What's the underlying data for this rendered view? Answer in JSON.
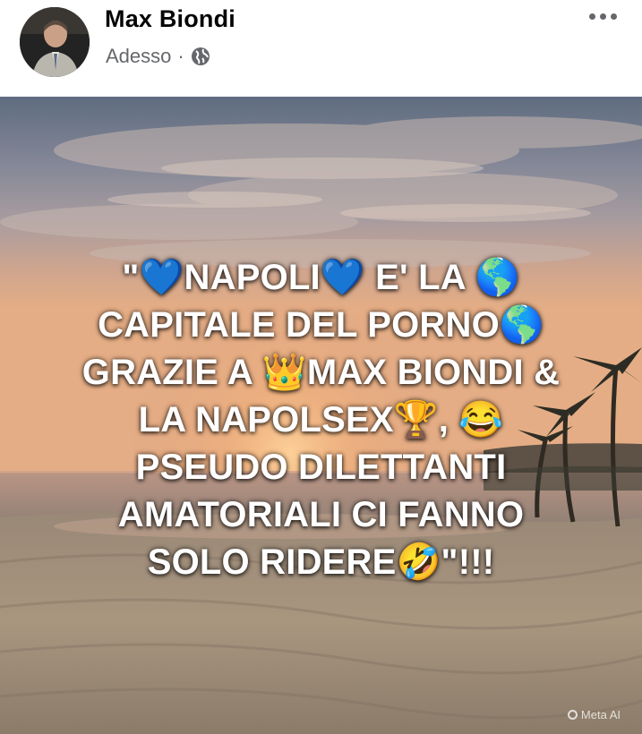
{
  "post": {
    "author": "Max Biondi",
    "timestamp": "Adesso",
    "separator": "·",
    "privacy_icon": "globe-icon",
    "more_icon": "more-options-icon"
  },
  "image": {
    "caption_lines": [
      "\"💙NAPOLI💙 E' LA 🌎",
      "CAPITALE DEL PORNO🌎",
      "GRAZIE A 👑MAX BIONDI &",
      "LA NAPOLSEX🏆, 😂",
      "PSEUDO DILETTANTI",
      "AMATORIALI CI FANNO",
      "SOLO RIDERE🤣\"!!!"
    ],
    "watermark": "Meta AI"
  }
}
